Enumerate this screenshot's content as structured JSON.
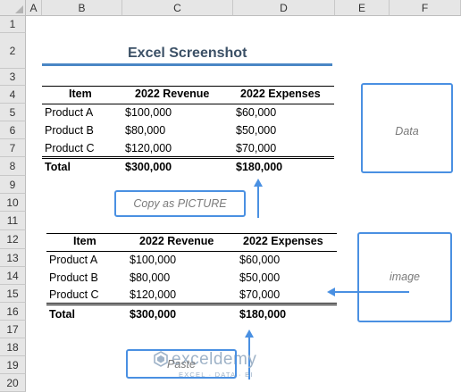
{
  "sheet": {
    "columns": [
      "A",
      "B",
      "C",
      "D",
      "E",
      "F"
    ],
    "rows": [
      "1",
      "2",
      "3",
      "4",
      "5",
      "6",
      "7",
      "8",
      "9",
      "10",
      "11",
      "12",
      "13",
      "14",
      "15",
      "16",
      "17",
      "18",
      "19",
      "20"
    ]
  },
  "title": "Excel Screenshot",
  "table1": {
    "headers": [
      "Item",
      "2022 Revenue",
      "2022 Expenses"
    ],
    "rows": [
      [
        "Product A",
        "$100,000",
        "$60,000"
      ],
      [
        "Product B",
        "$80,000",
        "$50,000"
      ],
      [
        "Product C",
        "$120,000",
        "$70,000"
      ]
    ],
    "total": [
      "Total",
      "$300,000",
      "$180,000"
    ]
  },
  "table2": {
    "headers": [
      "Item",
      "2022 Revenue",
      "2022 Expenses"
    ],
    "rows": [
      [
        "Product A",
        "$100,000",
        "$60,000"
      ],
      [
        "Product B",
        "$80,000",
        "$50,000"
      ],
      [
        "Product C",
        "$120,000",
        "$70,000"
      ]
    ],
    "total": [
      "Total",
      "$300,000",
      "$180,000"
    ]
  },
  "labels": {
    "data": "Data",
    "copy": "Copy as PICTURE",
    "image": "image",
    "paste": "Paste"
  },
  "watermark": {
    "name": "exceldemy",
    "tagline": "EXCEL · DATA · BI"
  },
  "colors": {
    "accent": "#4a90e2",
    "header_bg": "#e6e6e6"
  }
}
